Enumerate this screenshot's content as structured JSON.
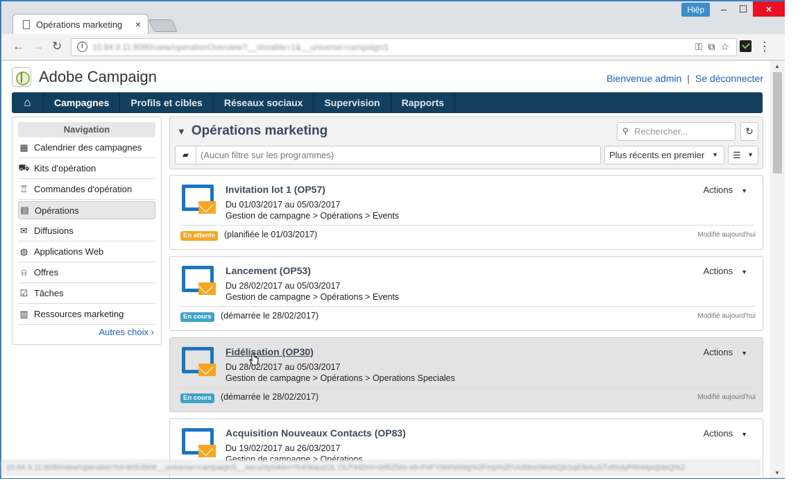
{
  "browser": {
    "user_badge": "Hiệp",
    "tab_title": "Opérations marketing",
    "tab_close": "×",
    "url": "10.84.9.11:8080/view/operationOverview?__storable=1&__universe=campaignS",
    "status_url": "10.84.9.11:8080/view/operation?id=8053908__universe=campaignS__securitytoken=%40kauzOL OLP442ml+lzf8256o-eb-PoFYM4N6Mg%2Fmp%2FUU5bs0WaNQbSqEIbAuSTvf0uIyPAhMpojbleQ%2",
    "win_min": "–",
    "win_max": "☐",
    "win_close": "×"
  },
  "app": {
    "brand": "Adobe Campaign",
    "welcome": "Bienvenue admin",
    "separator": "|",
    "logout": "Se déconnecter"
  },
  "mainnav": {
    "items": [
      "Campagnes",
      "Profils et cibles",
      "Réseaux sociaux",
      "Supervision",
      "Rapports"
    ]
  },
  "leftnav": {
    "title": "Navigation",
    "items": [
      {
        "label": "Calendrier des campagnes",
        "icon": "calendar-icon",
        "glyph": "▦"
      },
      {
        "label": "Kits d'opération",
        "icon": "kit-icon",
        "glyph": "⛟"
      },
      {
        "label": "Commandes d'opération",
        "icon": "order-icon",
        "glyph": "♖"
      },
      {
        "label": "Opérations",
        "icon": "operations-icon",
        "glyph": "▤"
      },
      {
        "label": "Diffusions",
        "icon": "envelope-icon",
        "glyph": "✉"
      },
      {
        "label": "Applications Web",
        "icon": "globe-icon",
        "glyph": "◍"
      },
      {
        "label": "Offres",
        "icon": "gift-icon",
        "glyph": "⍾"
      },
      {
        "label": "Tâches",
        "icon": "checkbox-icon",
        "glyph": "☑"
      },
      {
        "label": "Ressources marketing",
        "icon": "books-icon",
        "glyph": "▥"
      }
    ],
    "more": "Autres choix"
  },
  "panel": {
    "title": "Opérations marketing",
    "search_placeholder": "Rechercher...",
    "filter_text": "(Aucun filtre sur les programmes)",
    "sort_value": "Plus récents en premier"
  },
  "cards": [
    {
      "title": "Invitation lot 1 (OP57)",
      "dates": "Du 01/03/2017 au 05/03/2017",
      "path": "Gestion de campagne > Opérations > Events",
      "actions": "Actions",
      "status": "En attente",
      "status_text": "(planifiée le 01/03/2017)",
      "modified": "Modifié aujourd'hui"
    },
    {
      "title": "Lancement (OP53)",
      "dates": "Du 28/02/2017 au 05/03/2017",
      "path": "Gestion de campagne > Opérations > Events",
      "actions": "Actions",
      "status": "En cours",
      "status_text": "(démarrée le 28/02/2017)",
      "modified": "Modifié aujourd'hui"
    },
    {
      "title": "Fidélisation (OP30)",
      "dates": "Du 28/02/2017 au 05/03/2017",
      "path": "Gestion de campagne > Opérations > Operations Speciales",
      "actions": "Actions",
      "status": "En cours",
      "status_text": "(démarrée le 28/02/2017)",
      "modified": "Modifié aujourd'hui"
    },
    {
      "title": "Acquisition Nouveaux Contacts (OP83)",
      "dates": "Du 19/02/2017 au 26/03/2017",
      "path": "Gestion de campagne > Opérations",
      "actions": "Actions"
    }
  ],
  "colors": {
    "nav_bg": "#123f5e",
    "link": "#1a62b5",
    "status_waiting": "#f5a623",
    "status_running": "#3fa2c7",
    "operation_icon": "#1a75c2",
    "envelope": "#f7a623"
  }
}
